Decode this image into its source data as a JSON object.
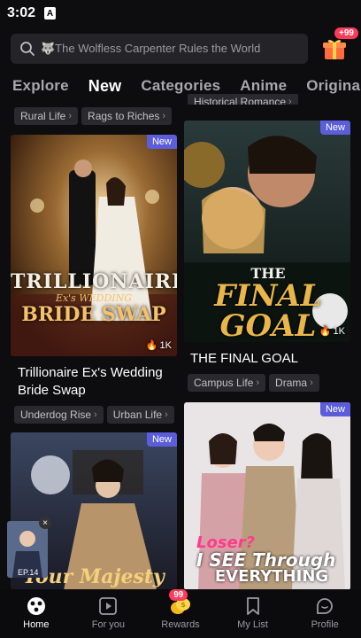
{
  "status": {
    "time": "3:02",
    "app_icon": "A"
  },
  "search": {
    "placeholder": "🐺The Wolfless Carpenter Rules the World"
  },
  "gift": {
    "badge": "+99"
  },
  "tabs": [
    {
      "label": "Explore"
    },
    {
      "label": "New"
    },
    {
      "label": "Categories"
    },
    {
      "label": "Anime"
    },
    {
      "label": "Origina"
    }
  ],
  "top_chips_left": [
    "Rural Life",
    "Rags to Riches"
  ],
  "top_chip_right": "Historical Romance",
  "cards": [
    {
      "title": "Trillionaire Ex's Wedding Bride Swap",
      "badge": "New",
      "views": "1K",
      "tags": [
        "Underdog Rise",
        "Urban Life"
      ],
      "cover_text": "TRILLIONAIRE Ex's WEDDING BRIDE SWAP"
    },
    {
      "title": "THE FINAL GOAL",
      "badge": "New",
      "views": "1K",
      "tags": [
        "Campus Life",
        "Drama"
      ],
      "cover_text": "THE FINAL GOAL"
    },
    {
      "badge": "New",
      "cover_text": "Your Majesty"
    },
    {
      "badge": "New",
      "cover_text": "Loser? I SEE Through EVERYTHING"
    }
  ],
  "mini_player": {
    "episode": "EP.14"
  },
  "nav": [
    {
      "label": "Home",
      "icon": "home-icon"
    },
    {
      "label": "For you",
      "icon": "play-square-icon"
    },
    {
      "label": "Rewards",
      "icon": "coins-icon",
      "badge": "99"
    },
    {
      "label": "My List",
      "icon": "bookmark-icon"
    },
    {
      "label": "Profile",
      "icon": "profile-icon"
    }
  ],
  "colors": {
    "accent_badge": "#5b5ddb",
    "notify": "#ff3b5c",
    "background": "#0d0d0f"
  }
}
